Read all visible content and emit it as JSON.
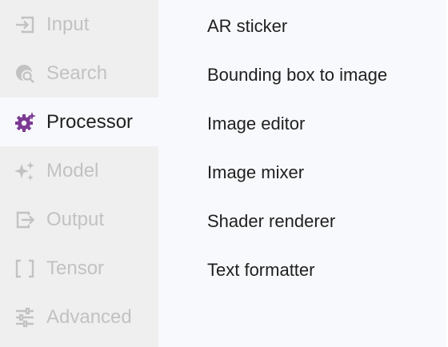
{
  "rail": {
    "items": [
      {
        "label": "Input",
        "icon": "input-icon",
        "active": false
      },
      {
        "label": "Search",
        "icon": "search-icon",
        "active": false
      },
      {
        "label": "Processor",
        "icon": "processor-gear-icon",
        "active": true
      },
      {
        "label": "Model",
        "icon": "sparkle-icon",
        "active": false
      },
      {
        "label": "Output",
        "icon": "output-icon",
        "active": false
      },
      {
        "label": "Tensor",
        "icon": "brackets-icon",
        "active": false
      },
      {
        "label": "Advanced",
        "icon": "tune-icon",
        "active": false
      }
    ]
  },
  "list": {
    "items": [
      {
        "label": "AR sticker"
      },
      {
        "label": "Bounding box to image"
      },
      {
        "label": "Image editor"
      },
      {
        "label": "Image mixer"
      },
      {
        "label": "Shader renderer"
      },
      {
        "label": "Text formatter"
      }
    ]
  },
  "colors": {
    "rail_bg": "#efefef",
    "panel_bg": "#f8f9fc",
    "inactive": "#c2c2c2",
    "text": "#1f1f1f",
    "accent": "#7b3a93"
  }
}
